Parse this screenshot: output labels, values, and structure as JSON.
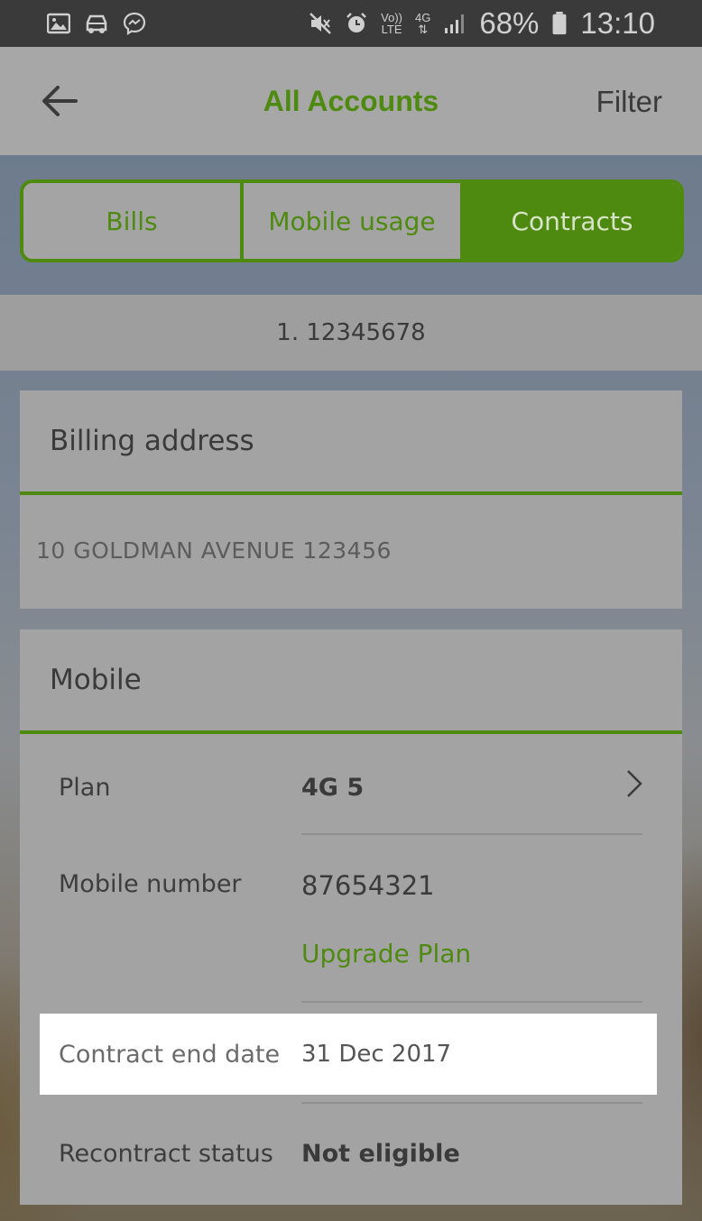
{
  "status_bar": {
    "battery": "68%",
    "time": "13:10",
    "volte_top": "Vo))",
    "volte_bottom": "LTE",
    "network": "4G"
  },
  "header": {
    "title": "All Accounts",
    "filter_label": "Filter"
  },
  "tabs": [
    {
      "label": "Bills",
      "active": false
    },
    {
      "label": "Mobile usage",
      "active": false
    },
    {
      "label": "Contracts",
      "active": true
    }
  ],
  "account": {
    "number": "1. 12345678"
  },
  "billing": {
    "heading": "Billing address",
    "address": "10 GOLDMAN AVENUE 123456"
  },
  "mobile": {
    "heading": "Mobile",
    "plan_label": "Plan",
    "plan_value": "4G 5",
    "number_label": "Mobile number",
    "number_value": "87654321",
    "upgrade_label": "Upgrade Plan",
    "contract_end_label": "Contract end date",
    "contract_end_value": "31 Dec 2017",
    "recontract_label": "Recontract status",
    "recontract_value": "Not eligible"
  },
  "colors": {
    "accent": "#4f8a10",
    "overlay_gray": "#a3a3a3",
    "status_bar": "#3a3a3a"
  }
}
